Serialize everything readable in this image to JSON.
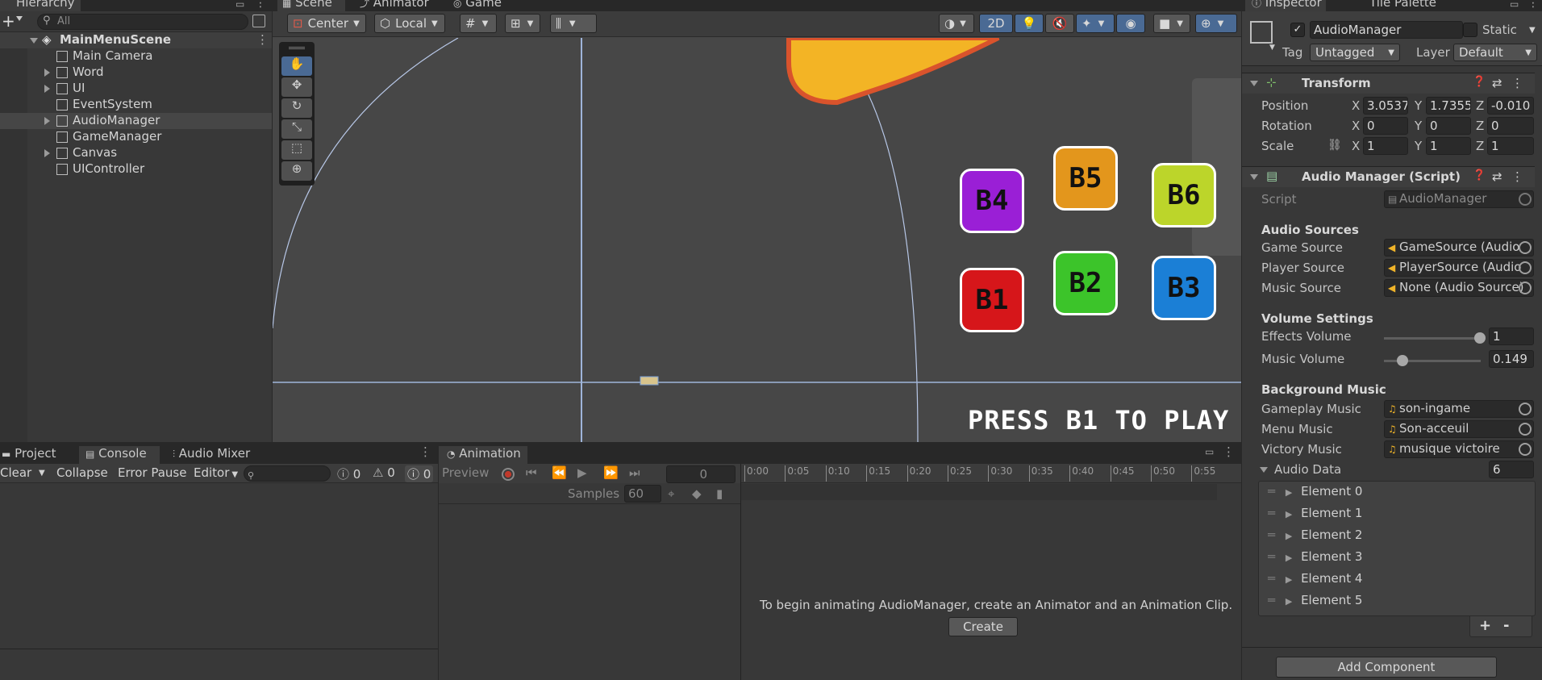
{
  "hierarchy": {
    "tab": "Hierarchy",
    "search_placeholder": "All",
    "add": "+",
    "scene": "MainMenuScene",
    "items": [
      "Main Camera",
      "Word",
      "UI",
      "EventSystem",
      "AudioManager",
      "GameManager",
      "Canvas",
      "UIController"
    ]
  },
  "scene_tabs": {
    "scene": "Scene",
    "animator": "Animator",
    "game": "Game"
  },
  "scene_toolbar": {
    "pivot": "Center",
    "space": "Local",
    "mode_2d": "2D"
  },
  "game_view": {
    "buttons": [
      {
        "label": "B4",
        "color": "#9a1fd6"
      },
      {
        "label": "B5",
        "color": "#e3961c"
      },
      {
        "label": "B6",
        "color": "#bcd52a"
      },
      {
        "label": "B1",
        "color": "#d6161a"
      },
      {
        "label": "B2",
        "color": "#3cc42a"
      },
      {
        "label": "B3",
        "color": "#1b7fd6"
      }
    ],
    "press_text": "PRESS B1 TO PLAY"
  },
  "inspector": {
    "tab": "Inspector",
    "tab2": "Tile Palette",
    "object_name": "AudioManager",
    "static_label": "Static",
    "tag_label": "Tag",
    "tag_value": "Untagged",
    "layer_label": "Layer",
    "layer_value": "Default",
    "transform": {
      "title": "Transform",
      "position_label": "Position",
      "rotation_label": "Rotation",
      "scale_label": "Scale",
      "position": {
        "x": "3.0537",
        "y": "1.7355",
        "z": "-0.010"
      },
      "rotation": {
        "x": "0",
        "y": "0",
        "z": "0"
      },
      "scale": {
        "x": "1",
        "y": "1",
        "z": "1"
      },
      "axis_x": "X",
      "axis_y": "Y",
      "axis_z": "Z"
    },
    "script_component": {
      "title": "Audio Manager (Script)",
      "script_label": "Script",
      "script_value": "AudioManager",
      "audio_sources_header": "Audio Sources",
      "game_source_label": "Game Source",
      "game_source_value": "GameSource (Audio",
      "player_source_label": "Player Source",
      "player_source_value": "PlayerSource (Audio",
      "music_source_label": "Music Source",
      "music_source_value": "None (Audio Source)",
      "volume_header": "Volume Settings",
      "effects_volume_label": "Effects Volume",
      "effects_volume_value": "1",
      "effects_volume_fraction": 1.0,
      "music_volume_label": "Music Volume",
      "music_volume_value": "0.149",
      "music_volume_fraction": 0.149,
      "bg_music_header": "Background Music",
      "gameplay_music_label": "Gameplay Music",
      "gameplay_music_value": "son-ingame",
      "menu_music_label": "Menu Music",
      "menu_music_value": "Son-acceuil",
      "victory_music_label": "Victory Music",
      "victory_music_value": "musique victoire",
      "audio_data_label": "Audio Data",
      "audio_data_count": "6",
      "elements": [
        "Element 0",
        "Element 1",
        "Element 2",
        "Element 3",
        "Element 4",
        "Element 5"
      ],
      "plus": "+",
      "minus": "-"
    },
    "add_component": "Add Component"
  },
  "console": {
    "tabs": [
      "Project",
      "Console",
      "Audio Mixer"
    ],
    "clear": "Clear",
    "collapse": "Collapse",
    "error_pause": "Error Pause",
    "editor": "Editor",
    "count_info": "0",
    "count_warn": "0",
    "count_error": "0"
  },
  "animation": {
    "tab": "Animation",
    "preview": "Preview",
    "frame": "0",
    "samples_label": "Samples",
    "samples_value": "60",
    "timeline": [
      "0:00",
      "0:05",
      "0:10",
      "0:15",
      "0:20",
      "0:25",
      "0:30",
      "0:35",
      "0:40",
      "0:45",
      "0:50",
      "0:55"
    ],
    "empty_message": "To begin animating AudioManager, create an Animator and an Animation Clip.",
    "create": "Create"
  }
}
